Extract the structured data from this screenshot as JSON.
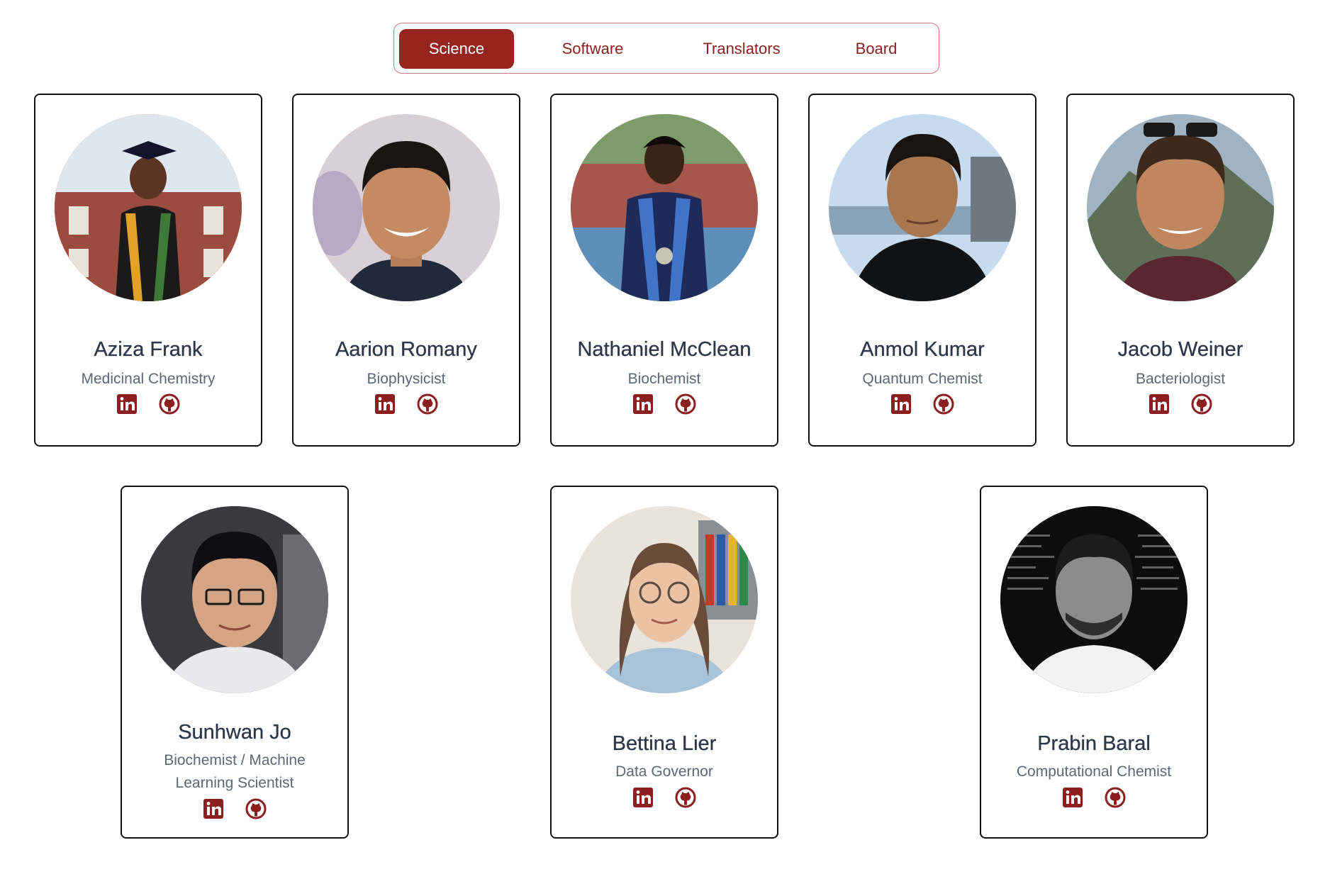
{
  "tabs": [
    {
      "label": "Science",
      "active": true
    },
    {
      "label": "Software",
      "active": false
    },
    {
      "label": "Translators",
      "active": false
    },
    {
      "label": "Board",
      "active": false
    }
  ],
  "accent_color": "#962520",
  "people": [
    {
      "name": "Aziza Frank",
      "role": "Medicinal Chemistry",
      "icons": [
        "linkedin-icon",
        "github-icon"
      ]
    },
    {
      "name": "Aarion Romany",
      "role": "Biophysicist",
      "icons": [
        "linkedin-icon",
        "github-icon"
      ]
    },
    {
      "name": "Nathaniel McClean",
      "role": "Biochemist",
      "icons": [
        "linkedin-icon",
        "github-icon"
      ]
    },
    {
      "name": "Anmol Kumar",
      "role": "Quantum Chemist",
      "icons": [
        "linkedin-icon",
        "github-icon"
      ]
    },
    {
      "name": "Jacob Weiner",
      "role": "Bacteriologist",
      "icons": [
        "linkedin-icon",
        "github-icon"
      ]
    },
    {
      "name": "Sunhwan Jo",
      "role": "Biochemist / Machine Learning Scientist",
      "icons": [
        "linkedin-icon",
        "github-icon"
      ]
    },
    {
      "name": "Bettina Lier",
      "role": "Data Governor",
      "icons": [
        "linkedin-icon",
        "github-icon"
      ]
    },
    {
      "name": "Prabin Baral",
      "role": "Computational Chemist",
      "icons": [
        "linkedin-icon",
        "github-icon"
      ]
    }
  ]
}
